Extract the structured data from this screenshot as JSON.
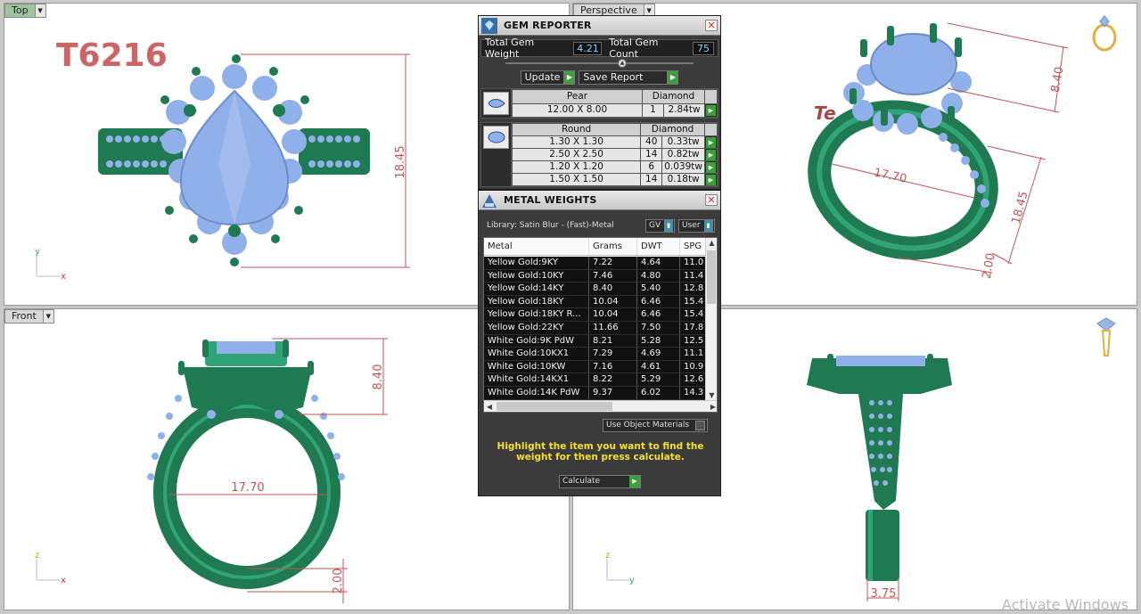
{
  "viewports": {
    "top": {
      "label": "Top",
      "ring_id": "T6216",
      "dimension": "18.45",
      "axis": [
        "y",
        "x"
      ]
    },
    "perspective": {
      "label": "Perspective",
      "dimensions": [
        "8.40",
        "17.70",
        "18.45",
        "2.00"
      ],
      "engraving": "Te"
    },
    "front": {
      "label": "Front",
      "dimensions": [
        "8.40",
        "17.70",
        "2.00"
      ],
      "axis": [
        "z",
        "x"
      ]
    },
    "right": {
      "dimension": "3.75",
      "axis": [
        "z",
        "y"
      ]
    }
  },
  "gem_reporter": {
    "title": "GEM REPORTER",
    "total_gem_weight_label": "Total Gem Weight",
    "total_gem_weight": "4.21",
    "total_gem_count_label": "Total Gem Count",
    "total_gem_count": "75",
    "update_label": "Update",
    "save_report_label": "Save Report",
    "groups": [
      {
        "shape": "Pear",
        "material": "Diamond",
        "rows": [
          {
            "size": "12.00 X 8.00",
            "count": "1",
            "weight": "2.84tw"
          }
        ]
      },
      {
        "shape": "Round",
        "material": "Diamond",
        "rows": [
          {
            "size": "1.30 X 1.30",
            "count": "40",
            "weight": "0.33tw"
          },
          {
            "size": "2.50 X 2.50",
            "count": "14",
            "weight": "0.82tw"
          },
          {
            "size": "1.20 X 1.20",
            "count": "6",
            "weight": "0.039tw"
          },
          {
            "size": "1.50 X 1.50",
            "count": "14",
            "weight": "0.18tw"
          }
        ]
      }
    ]
  },
  "metal_weights": {
    "title": "METAL WEIGHTS",
    "library": "Library: Satin Blur - (Fast)-Metal",
    "gv_label": "GV",
    "user_label": "User",
    "columns": [
      "Metal",
      "Grams",
      "DWT",
      "SPG"
    ],
    "rows": [
      {
        "metal": "Yellow Gold:9KY",
        "grams": "7.22",
        "dwt": "4.64",
        "spg": "11.0"
      },
      {
        "metal": "Yellow Gold:10KY",
        "grams": "7.46",
        "dwt": "4.80",
        "spg": "11.4"
      },
      {
        "metal": "Yellow Gold:14KY",
        "grams": "8.40",
        "dwt": "5.40",
        "spg": "12.8"
      },
      {
        "metal": "Yellow Gold:18KY",
        "grams": "10.04",
        "dwt": "6.46",
        "spg": "15.4"
      },
      {
        "metal": "Yellow Gold:18KY R...",
        "grams": "10.04",
        "dwt": "6.46",
        "spg": "15.4"
      },
      {
        "metal": "Yellow Gold:22KY",
        "grams": "11.66",
        "dwt": "7.50",
        "spg": "17.8"
      },
      {
        "metal": "White Gold:9K PdW",
        "grams": "8.21",
        "dwt": "5.28",
        "spg": "12.5"
      },
      {
        "metal": "White Gold:10KX1",
        "grams": "7.29",
        "dwt": "4.69",
        "spg": "11.1"
      },
      {
        "metal": "White Gold:10KW",
        "grams": "7.16",
        "dwt": "4.61",
        "spg": "10.9"
      },
      {
        "metal": "White Gold:14KX1",
        "grams": "8.22",
        "dwt": "5.29",
        "spg": "12.6"
      },
      {
        "metal": "White Gold:14K PdW",
        "grams": "9.37",
        "dwt": "6.02",
        "spg": "14.3"
      }
    ],
    "use_object_materials": "Use Object Materials",
    "hint": "Highlight the item you want to find the weight for then press calculate.",
    "calculate_label": "Calculate"
  },
  "watermark": "Activate Windows",
  "colors": {
    "metal": "#1f7a52",
    "metal_light": "#2fa577",
    "gem": "#8fb0e8",
    "dimension": "#c25555",
    "panel": "#3b3b3b"
  }
}
